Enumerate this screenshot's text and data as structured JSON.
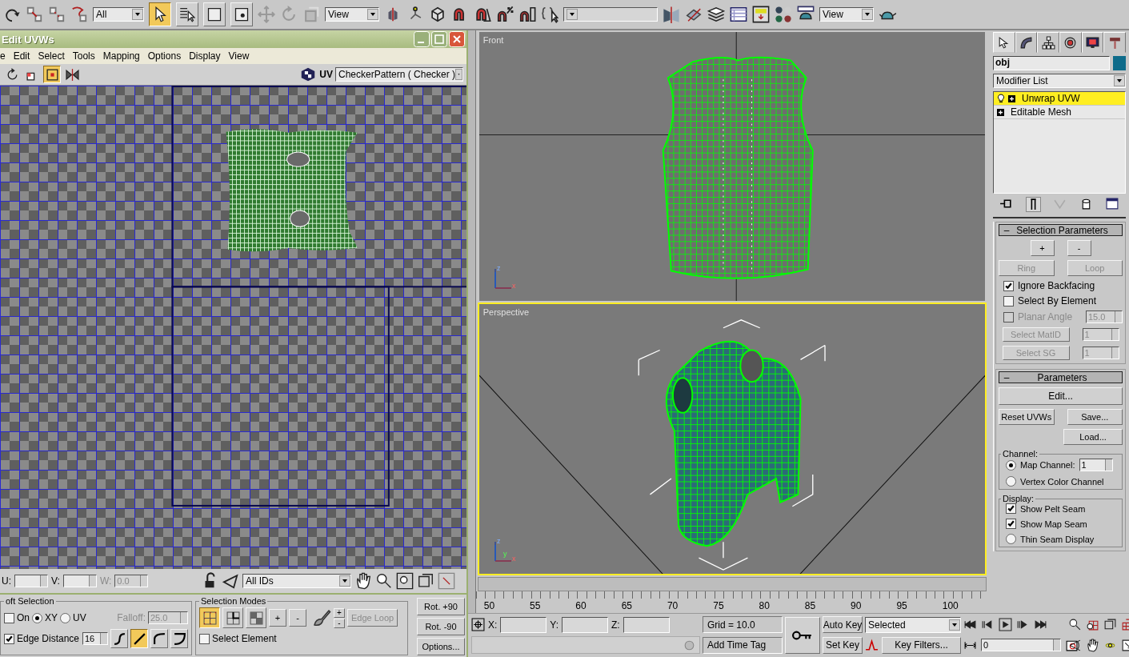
{
  "toolbar": {
    "selection_filter": "All",
    "select_tools": [
      {
        "selected": true
      },
      {
        "selected": false
      },
      {
        "selected": false
      },
      {
        "selected": false
      }
    ],
    "coordinate_system": "View",
    "render_view": "View"
  },
  "uv_editor": {
    "title": "Edit UVWs",
    "menus": [
      "e",
      "Edit",
      "Select",
      "Tools",
      "Mapping",
      "Options",
      "Display",
      "View"
    ],
    "tools": [
      {
        "selected": false
      },
      {
        "selected": false
      },
      {
        "selected": true
      },
      {
        "selected": false
      }
    ],
    "channel_label": "UV",
    "texture": "CheckerPattern  ( Checker )",
    "u": {
      "label": "U:"
    },
    "v": {
      "label": "V:"
    },
    "w": {
      "label": "W:",
      "value": "0.0",
      "disabled": true
    },
    "id_filter": "All IDs",
    "soft_selection": {
      "title": "oft Selection",
      "on": {
        "label": "On",
        "checked": false
      },
      "space": [
        {
          "label": "XY",
          "selected": true
        },
        {
          "label": "UV",
          "selected": false
        }
      ],
      "falloff": {
        "label": "Falloff:",
        "value": "25.0",
        "disabled": true
      },
      "edge_distance": {
        "label": "Edge Distance",
        "checked": true,
        "value": "16"
      },
      "curves": [
        {
          "selected": false
        },
        {
          "selected": true
        },
        {
          "selected": false
        },
        {
          "selected": false
        }
      ]
    },
    "selection_modes": {
      "title": "Selection Modes",
      "modes": [
        {
          "selected": true
        },
        {
          "selected": false
        },
        {
          "selected": false
        }
      ],
      "grow": "+",
      "shrink": "-",
      "paint_grow": "+",
      "paint_shrink": "-",
      "edge_loop": {
        "label": "Edge Loop",
        "disabled": true
      },
      "select_element": {
        "label": "Select Element",
        "checked": false
      }
    },
    "rotate_buttons": [
      "Rot. +90",
      "Rot. -90"
    ],
    "options_button": "Options..."
  },
  "viewports": [
    {
      "label": "Front",
      "selected": false,
      "kind": "front",
      "axes": [
        "z",
        "x"
      ]
    },
    {
      "label": "Perspective",
      "selected": true,
      "kind": "perspective",
      "axes": [
        "z",
        "y",
        "x"
      ]
    }
  ],
  "timeline": {
    "ticks": [
      "50",
      "55",
      "60",
      "65",
      "70",
      "75",
      "80",
      "85",
      "90",
      "95",
      "100"
    ]
  },
  "command_panel": {
    "tabs": [
      {
        "selected": true
      },
      {
        "selected": false
      },
      {
        "selected": false
      },
      {
        "selected": false
      },
      {
        "selected": false
      },
      {
        "selected": false
      }
    ],
    "object_name": "obj",
    "modifier_list": "Modifier List",
    "stack": [
      {
        "label": "Unwrap UVW",
        "selected": true,
        "bulb": true
      },
      {
        "label": "Editable Mesh",
        "selected": false,
        "bulb": false
      }
    ],
    "selection_parameters": {
      "toggle": "–",
      "title": "Selection Parameters",
      "grow": "+",
      "shrink": "-",
      "ring": {
        "label": "Ring",
        "disabled": true
      },
      "loop": {
        "label": "Loop",
        "disabled": true
      },
      "checks": [
        {
          "label": "Ignore Backfacing",
          "checked": true,
          "disabled": false
        },
        {
          "label": "Select By Element",
          "checked": false,
          "disabled": false
        },
        {
          "label": "Planar Angle",
          "checked": false,
          "disabled": true
        }
      ],
      "planar_angle": "15.0",
      "id_buttons": [
        {
          "label": "Select MatID",
          "value": "1",
          "disabled": true
        },
        {
          "label": "Select SG",
          "value": "1",
          "disabled": true
        }
      ]
    },
    "parameters": {
      "toggle": "–",
      "title": "Parameters",
      "edit": "Edit...",
      "reset": "Reset UVWs",
      "save": "Save...",
      "load": "Load...",
      "channel": {
        "title": "Channel:",
        "options": [
          {
            "label": "Map Channel:",
            "selected": true,
            "value": "1"
          },
          {
            "label": "Vertex Color Channel",
            "selected": false
          }
        ]
      },
      "display": {
        "title": "Display:",
        "checks": [
          {
            "label": "Show Pelt Seam",
            "checked": true
          },
          {
            "label": "Show Map Seam",
            "checked": true
          }
        ],
        "radio": {
          "label": "Thin Seam Display",
          "selected": false
        }
      }
    }
  },
  "status_bar": {
    "x_label": "X:",
    "y_label": "Y:",
    "z_label": "Z:",
    "grid": "Grid = 10.0",
    "time_tag": "Add Time Tag",
    "auto_key": "Auto Key",
    "set_key": "Set Key",
    "key_mode": "Selected",
    "key_filters": "Key Filters...",
    "frame": "0"
  }
}
